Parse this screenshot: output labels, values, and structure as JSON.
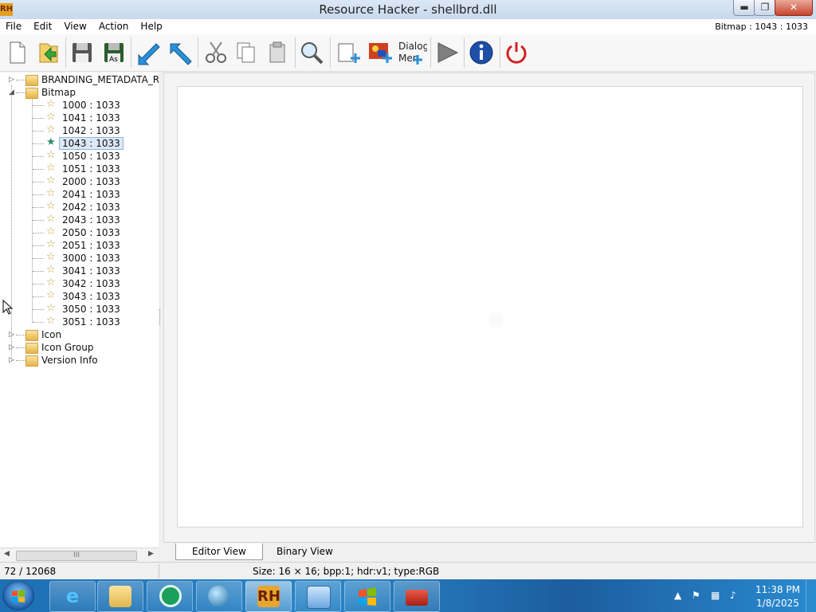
{
  "window": {
    "title": "Resource Hacker - shellbrd.dll",
    "app_icon_text": "RH",
    "minimize": "▬",
    "maximize": "❐",
    "close": "✕"
  },
  "menu": {
    "items": [
      "File",
      "Edit",
      "View",
      "Action",
      "Help"
    ],
    "status": "Bitmap : 1043 : 1033"
  },
  "toolbar": {
    "buttons": [
      {
        "name": "new-file-icon"
      },
      {
        "name": "open-file-icon"
      },
      {
        "name": "save-icon"
      },
      {
        "name": "save-as-icon",
        "text": "As"
      },
      {
        "name": "compile-arrow-icon"
      },
      {
        "name": "resource-arrow-icon"
      },
      {
        "name": "cut-icon"
      },
      {
        "name": "copy-icon"
      },
      {
        "name": "paste-icon"
      },
      {
        "name": "find-icon"
      },
      {
        "name": "add-blank-resource-icon"
      },
      {
        "name": "add-image-resource-icon"
      },
      {
        "name": "dialog-menu-icon",
        "text_top": "Dialog",
        "text_bottom": "Mer"
      },
      {
        "name": "play-icon"
      },
      {
        "name": "info-icon"
      },
      {
        "name": "power-icon"
      }
    ]
  },
  "tree": {
    "top_nodes": [
      {
        "label": "BRANDING_METADATA_RE",
        "expanded": false
      },
      {
        "label": "Bitmap",
        "expanded": true
      },
      {
        "label": "Icon",
        "expanded": false
      },
      {
        "label": "Icon Group",
        "expanded": false
      },
      {
        "label": "Version Info",
        "expanded": false
      }
    ],
    "bitmap_children": [
      "1000 : 1033",
      "1041 : 1033",
      "1042 : 1033",
      "1043 : 1033",
      "1050 : 1033",
      "1051 : 1033",
      "2000 : 1033",
      "2041 : 1033",
      "2042 : 1033",
      "2043 : 1033",
      "2050 : 1033",
      "2051 : 1033",
      "3000 : 1033",
      "3041 : 1033",
      "3042 : 1033",
      "3043 : 1033",
      "3050 : 1033",
      "3051 : 1033"
    ],
    "selected": "1043 : 1033",
    "hscroll_grip": "III"
  },
  "tabs": {
    "editor": "Editor View",
    "binary": "Binary View"
  },
  "status": {
    "left": "72 / 12068",
    "right": "Size: 16 × 16;  bpp:1;  hdr:v1;  type:RGB"
  },
  "taskbar": {
    "items": [
      {
        "name": "internet-explorer",
        "active": false
      },
      {
        "name": "file-explorer",
        "active": false
      },
      {
        "name": "green-circle-app",
        "active": false
      },
      {
        "name": "globe-app",
        "active": false
      },
      {
        "name": "resource-hacker",
        "label": "RH",
        "active": true
      },
      {
        "name": "control-panel",
        "active": false
      },
      {
        "name": "windows-flag-app",
        "active": false
      },
      {
        "name": "toolbox-app",
        "active": false
      }
    ],
    "clock_time": "11:38 PM",
    "clock_date": "1/8/2025"
  },
  "colors": {
    "accent": "#2a86c8",
    "selection": "#dce8f6",
    "star": "#c69a3a"
  }
}
